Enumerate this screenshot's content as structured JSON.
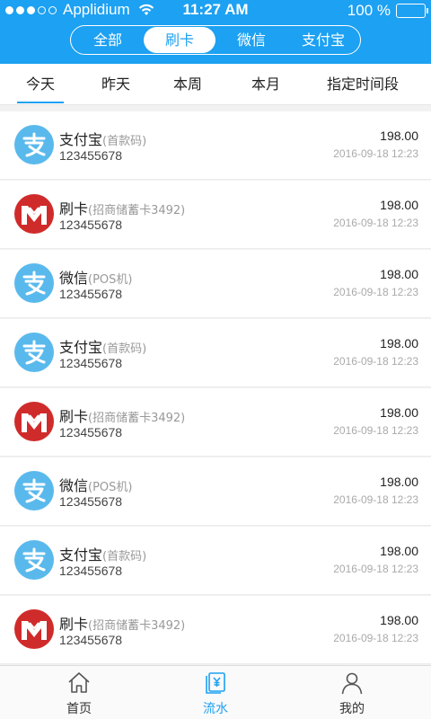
{
  "status_bar": {
    "carrier": "Applidium",
    "time": "11:27 AM",
    "battery": "100 %",
    "signal_bars_filled": 3,
    "signal_bars_total": 5
  },
  "filter_segments": [
    {
      "label": "全部",
      "active": false
    },
    {
      "label": "刷卡",
      "active": true
    },
    {
      "label": "微信",
      "active": false
    },
    {
      "label": "支付宝",
      "active": false
    }
  ],
  "date_tabs": [
    {
      "label": "今天",
      "active": true
    },
    {
      "label": "昨天",
      "active": false
    },
    {
      "label": "本周",
      "active": false
    },
    {
      "label": "本月",
      "active": false
    },
    {
      "label": "指定时间段",
      "active": false
    }
  ],
  "transactions": [
    {
      "icon": "alipay-icon",
      "name": "支付宝",
      "sub": "(首款码)",
      "number": "123455678",
      "amount": "198.00",
      "date": "2016-09-18 12:23"
    },
    {
      "icon": "cmb-bank-icon",
      "name": "刷卡",
      "sub": "(招商储蓄卡3492)",
      "number": "123455678",
      "amount": "198.00",
      "date": "2016-09-18 12:23"
    },
    {
      "icon": "alipay-icon",
      "name": "微信",
      "sub": "(POS机)",
      "number": "123455678",
      "amount": "198.00",
      "date": "2016-09-18 12:23"
    },
    {
      "icon": "alipay-icon",
      "name": "支付宝",
      "sub": "(首款码)",
      "number": "123455678",
      "amount": "198.00",
      "date": "2016-09-18 12:23"
    },
    {
      "icon": "cmb-bank-icon",
      "name": "刷卡",
      "sub": "(招商储蓄卡3492)",
      "number": "123455678",
      "amount": "198.00",
      "date": "2016-09-18 12:23"
    },
    {
      "icon": "alipay-icon",
      "name": "微信",
      "sub": "(POS机)",
      "number": "123455678",
      "amount": "198.00",
      "date": "2016-09-18 12:23"
    },
    {
      "icon": "alipay-icon",
      "name": "支付宝",
      "sub": "(首款码)",
      "number": "123455678",
      "amount": "198.00",
      "date": "2016-09-18 12:23"
    },
    {
      "icon": "cmb-bank-icon",
      "name": "刷卡",
      "sub": "(招商储蓄卡3492)",
      "number": "123455678",
      "amount": "198.00",
      "date": "2016-09-18 12:23"
    }
  ],
  "bottom_nav": [
    {
      "label": "首页",
      "icon": "home-icon",
      "active": false
    },
    {
      "label": "流水",
      "icon": "ledger-icon",
      "active": true
    },
    {
      "label": "我的",
      "icon": "user-icon",
      "active": false
    }
  ],
  "colors": {
    "accent": "#1da1f2",
    "alipay": "#5ab9ec",
    "cmb": "#d02b2b"
  }
}
